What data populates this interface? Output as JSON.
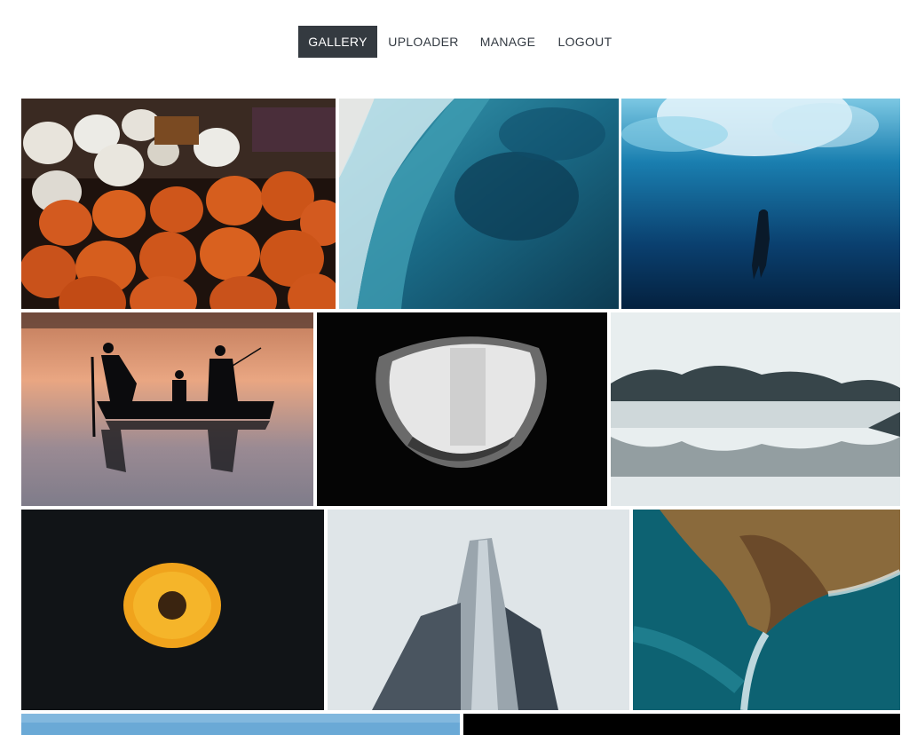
{
  "nav": {
    "items": [
      {
        "label": "GALLERY",
        "active": true
      },
      {
        "label": "UPLOADER",
        "active": false
      },
      {
        "label": "MANAGE",
        "active": false
      },
      {
        "label": "LOGOUT",
        "active": false
      }
    ]
  },
  "gallery": {
    "photos": [
      {
        "subject": "pumpkins",
        "colors": [
          "#1e120d",
          "#d35a1f",
          "#e8e4dc"
        ]
      },
      {
        "subject": "ocean-waves-aerial",
        "colors": [
          "#0d3b52",
          "#2b8fa8",
          "#d9eef2"
        ]
      },
      {
        "subject": "underwater-diver",
        "colors": [
          "#04213f",
          "#0f5a8a",
          "#a8dbef"
        ]
      },
      {
        "subject": "fishing-boat-silhouette",
        "colors": [
          "#e9a682",
          "#7f7c8a",
          "#0b0b0d"
        ]
      },
      {
        "subject": "building-looking-up",
        "colors": [
          "#050505",
          "#7a7a7a",
          "#e6e6e6"
        ]
      },
      {
        "subject": "misty-lake-trees",
        "colors": [
          "#e8eeef",
          "#37454a",
          "#b6c3c6"
        ]
      },
      {
        "subject": "yellow-flower",
        "colors": [
          "#111417",
          "#f0a31c",
          "#3a2410"
        ]
      },
      {
        "subject": "skyscraper",
        "colors": [
          "#dfe5e8",
          "#7f8a93",
          "#26303a"
        ]
      },
      {
        "subject": "coastline-aerial",
        "colors": [
          "#0d6272",
          "#8a6a3c",
          "#eaf5f7"
        ]
      },
      {
        "subject": "sky-landscape",
        "colors": [
          "#6aa9d6"
        ]
      },
      {
        "subject": "dark-photo",
        "colors": [
          "#000000"
        ]
      }
    ]
  }
}
